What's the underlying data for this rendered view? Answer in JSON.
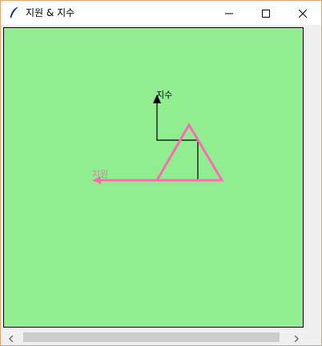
{
  "window": {
    "title": "지원 & 지수",
    "app_icon": "feather-icon",
    "controls": {
      "minimize_icon": "minimize-icon",
      "maximize_icon": "maximize-icon",
      "close_icon": "close-icon"
    }
  },
  "canvas": {
    "background": "#90ee90",
    "turtles": [
      {
        "label": "지수",
        "color": "#000000"
      },
      {
        "label": "지원",
        "color": "#ff69b4"
      }
    ]
  },
  "scrollbars": {
    "left_arrow_icon": "chevron-left-icon",
    "right_arrow_icon": "chevron-right-icon"
  }
}
